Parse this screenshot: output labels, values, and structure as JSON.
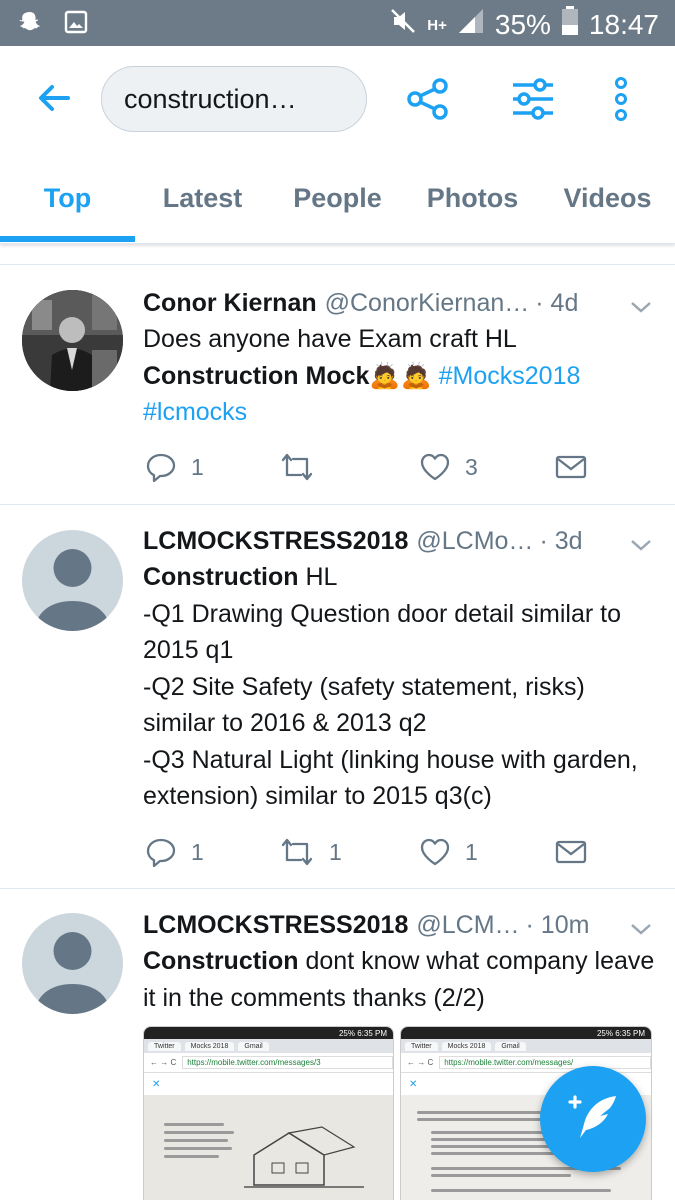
{
  "status_bar": {
    "network_label": "H+",
    "battery_percent": "35%",
    "time": "18:47",
    "icons": [
      "snapchat-icon",
      "gallery-icon",
      "mute-icon",
      "signal-icon",
      "battery-icon"
    ]
  },
  "header": {
    "search_value": "construction…",
    "icons": [
      "back-arrow-icon",
      "share-icon",
      "filter-icon",
      "more-vertical-icon"
    ]
  },
  "tabs": [
    {
      "label": "Top",
      "active": true
    },
    {
      "label": "Latest",
      "active": false
    },
    {
      "label": "People",
      "active": false
    },
    {
      "label": "Photos",
      "active": false
    },
    {
      "label": "Videos",
      "active": false
    }
  ],
  "tweets": [
    {
      "name": "Conor Kiernan",
      "handle": "@ConorKiernan…",
      "time": "· 4d",
      "text_line1": "Does anyone have Exam craft HL",
      "text_bold": "Construction Mock",
      "emoji": "🙇🙇",
      "hashtag1": "#Mocks2018",
      "hashtag2": "#lcmocks",
      "replies": "1",
      "retweets": "",
      "likes": "3"
    },
    {
      "name": "LCMOCKSTRESS2018",
      "handle": "@LCMo…",
      "time": "· 3d",
      "text_bold": "Construction",
      "text_after_bold": " HL",
      "line2": "-Q1 Drawing Question door detail similar to 2015 q1",
      "line3": "-Q2 Site Safety (safety statement, risks) similar to 2016 & 2013 q2",
      "line4": "-Q3 Natural Light (linking house with garden, extension) similar to 2015 q3(c)",
      "replies": "1",
      "retweets": "1",
      "likes": "1"
    },
    {
      "name": "LCMOCKSTRESS2018",
      "handle": "@LCM…",
      "time": "· 10m",
      "text_bold": "Construction",
      "text_after_bold": " dont know what company leave it in the comments thanks  (2/2)",
      "media": [
        {
          "tab1": "Twitter",
          "tab2": "Mocks 2018",
          "tab3": "Gmail",
          "url": "https://mobile.twitter.com/messages/3",
          "status": "25% 6:35 PM"
        },
        {
          "tab1": "Twitter",
          "tab2": "Mocks 2018",
          "tab3": "Gmail",
          "url": "https://mobile.twitter.com/messages/",
          "status": "25% 6:35 PM"
        }
      ]
    }
  ],
  "colors": {
    "accent": "#1da1f2",
    "status_bar": "#6d7b89",
    "secondary_text": "#657786",
    "divider": "#e1e8ed"
  }
}
